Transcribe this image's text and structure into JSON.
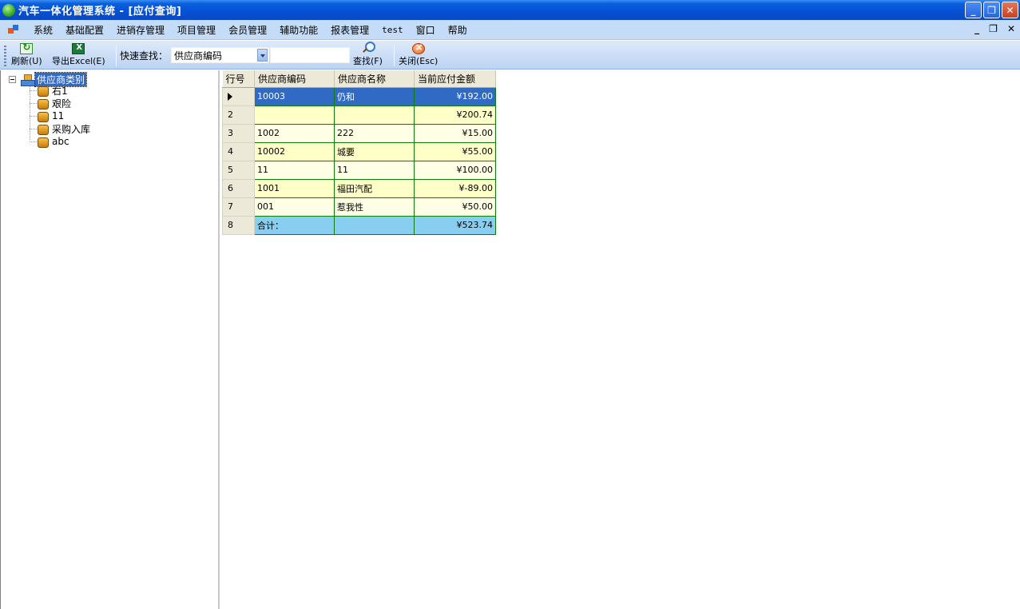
{
  "window": {
    "title": "汽车一体化管理系统 - [应付查询]"
  },
  "menu": {
    "items": [
      "系统",
      "基础配置",
      "进销存管理",
      "项目管理",
      "会员管理",
      "辅助功能",
      "报表管理",
      "test",
      "窗口",
      "帮助"
    ]
  },
  "toolbar": {
    "refresh_label": "刷新(U)",
    "export_label": "导出Excel(E)",
    "quick_search_label": "快速查找：",
    "search_field_value": "供应商编码",
    "search_input_value": "",
    "find_label": "查找(F)",
    "close_label": "关闭(Esc)"
  },
  "tree": {
    "root_label": "供应商类别",
    "children": [
      "右1",
      "艰险",
      "11",
      "采购入库",
      "abc"
    ]
  },
  "grid": {
    "headers": [
      "行号",
      "供应商编码",
      "供应商名称",
      "当前应付金额"
    ],
    "rows": [
      {
        "no": "",
        "code": "10003",
        "name": "仍和",
        "amount": "¥192.00"
      },
      {
        "no": "2",
        "code": "",
        "name": "",
        "amount": "¥200.74"
      },
      {
        "no": "3",
        "code": "1002",
        "name": "222",
        "amount": "¥15.00"
      },
      {
        "no": "4",
        "code": "10002",
        "name": "城要",
        "amount": "¥55.00"
      },
      {
        "no": "5",
        "code": "11",
        "name": "11",
        "amount": "¥100.00"
      },
      {
        "no": "6",
        "code": "1001",
        "name": "福田汽配",
        "amount": "¥-89.00"
      },
      {
        "no": "7",
        "code": "001",
        "name": "惹我性",
        "amount": "¥50.00"
      },
      {
        "no": "8",
        "code": "合计：",
        "name": "",
        "amount": "¥523.74"
      }
    ]
  }
}
